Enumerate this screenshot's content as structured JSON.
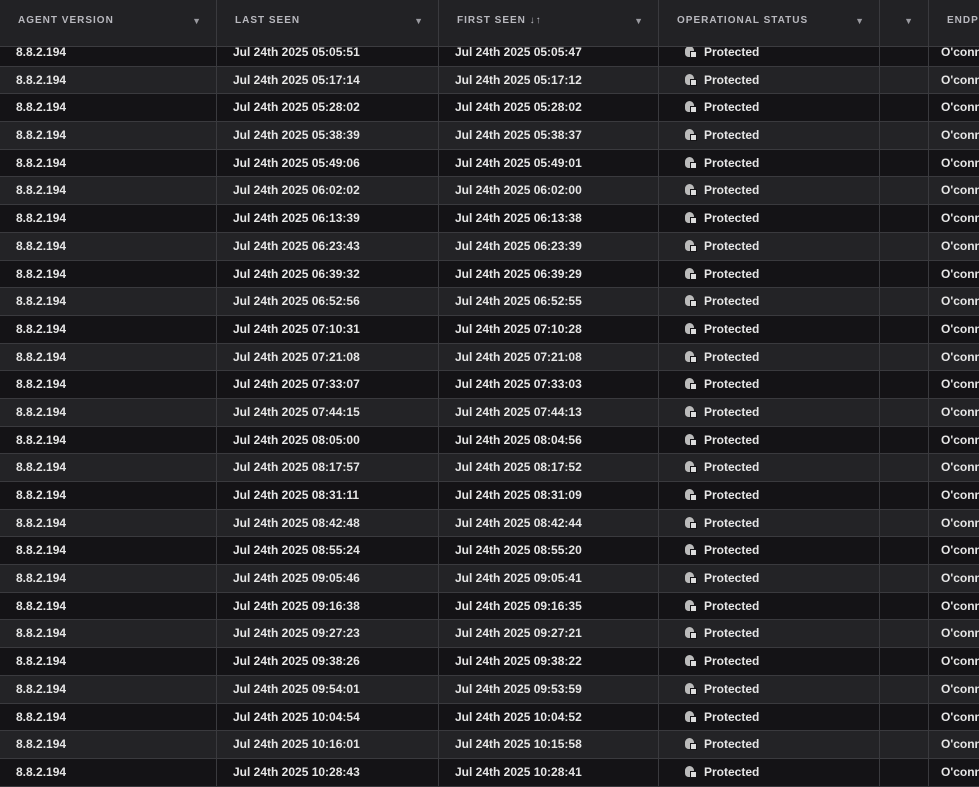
{
  "columns": [
    {
      "label": "AGENT VERSION",
      "filter": true
    },
    {
      "label": "LAST SEEN",
      "filter": true
    },
    {
      "label": "FIRST SEEN ↓↑",
      "filter": true
    },
    {
      "label": "OPERATIONAL STATUS",
      "filter": true
    },
    {
      "label": "",
      "filter": true
    },
    {
      "label": "ENDP",
      "filter": false
    }
  ],
  "filter_icon": "▼",
  "rows": [
    [
      "8.8.2.194",
      "Jul 24th 2025 05:05:51",
      "Jul 24th 2025 05:05:47",
      "Protected",
      "",
      "O'conn"
    ],
    [
      "8.8.2.194",
      "Jul 24th 2025 05:17:14",
      "Jul 24th 2025 05:17:12",
      "Protected",
      "",
      "O'conn"
    ],
    [
      "8.8.2.194",
      "Jul 24th 2025 05:28:02",
      "Jul 24th 2025 05:28:02",
      "Protected",
      "",
      "O'conn"
    ],
    [
      "8.8.2.194",
      "Jul 24th 2025 05:38:39",
      "Jul 24th 2025 05:38:37",
      "Protected",
      "",
      "O'conn"
    ],
    [
      "8.8.2.194",
      "Jul 24th 2025 05:49:06",
      "Jul 24th 2025 05:49:01",
      "Protected",
      "",
      "O'conn"
    ],
    [
      "8.8.2.194",
      "Jul 24th 2025 06:02:02",
      "Jul 24th 2025 06:02:00",
      "Protected",
      "",
      "O'conn"
    ],
    [
      "8.8.2.194",
      "Jul 24th 2025 06:13:39",
      "Jul 24th 2025 06:13:38",
      "Protected",
      "",
      "O'conn"
    ],
    [
      "8.8.2.194",
      "Jul 24th 2025 06:23:43",
      "Jul 24th 2025 06:23:39",
      "Protected",
      "",
      "O'conn"
    ],
    [
      "8.8.2.194",
      "Jul 24th 2025 06:39:32",
      "Jul 24th 2025 06:39:29",
      "Protected",
      "",
      "O'conn"
    ],
    [
      "8.8.2.194",
      "Jul 24th 2025 06:52:56",
      "Jul 24th 2025 06:52:55",
      "Protected",
      "",
      "O'conn"
    ],
    [
      "8.8.2.194",
      "Jul 24th 2025 07:10:31",
      "Jul 24th 2025 07:10:28",
      "Protected",
      "",
      "O'conn"
    ],
    [
      "8.8.2.194",
      "Jul 24th 2025 07:21:08",
      "Jul 24th 2025 07:21:08",
      "Protected",
      "",
      "O'conn"
    ],
    [
      "8.8.2.194",
      "Jul 24th 2025 07:33:07",
      "Jul 24th 2025 07:33:03",
      "Protected",
      "",
      "O'conn"
    ],
    [
      "8.8.2.194",
      "Jul 24th 2025 07:44:15",
      "Jul 24th 2025 07:44:13",
      "Protected",
      "",
      "O'conn"
    ],
    [
      "8.8.2.194",
      "Jul 24th 2025 08:05:00",
      "Jul 24th 2025 08:04:56",
      "Protected",
      "",
      "O'conn"
    ],
    [
      "8.8.2.194",
      "Jul 24th 2025 08:17:57",
      "Jul 24th 2025 08:17:52",
      "Protected",
      "",
      "O'conn"
    ],
    [
      "8.8.2.194",
      "Jul 24th 2025 08:31:11",
      "Jul 24th 2025 08:31:09",
      "Protected",
      "",
      "O'conn"
    ],
    [
      "8.8.2.194",
      "Jul 24th 2025 08:42:48",
      "Jul 24th 2025 08:42:44",
      "Protected",
      "",
      "O'conn"
    ],
    [
      "8.8.2.194",
      "Jul 24th 2025 08:55:24",
      "Jul 24th 2025 08:55:20",
      "Protected",
      "",
      "O'conn"
    ],
    [
      "8.8.2.194",
      "Jul 24th 2025 09:05:46",
      "Jul 24th 2025 09:05:41",
      "Protected",
      "",
      "O'conn"
    ],
    [
      "8.8.2.194",
      "Jul 24th 2025 09:16:38",
      "Jul 24th 2025 09:16:35",
      "Protected",
      "",
      "O'conn"
    ],
    [
      "8.8.2.194",
      "Jul 24th 2025 09:27:23",
      "Jul 24th 2025 09:27:21",
      "Protected",
      "",
      "O'conn"
    ],
    [
      "8.8.2.194",
      "Jul 24th 2025 09:38:26",
      "Jul 24th 2025 09:38:22",
      "Protected",
      "",
      "O'conn"
    ],
    [
      "8.8.2.194",
      "Jul 24th 2025 09:54:01",
      "Jul 24th 2025 09:53:59",
      "Protected",
      "",
      "O'conn"
    ],
    [
      "8.8.2.194",
      "Jul 24th 2025 10:04:54",
      "Jul 24th 2025 10:04:52",
      "Protected",
      "",
      "O'conn"
    ],
    [
      "8.8.2.194",
      "Jul 24th 2025 10:16:01",
      "Jul 24th 2025 10:15:58",
      "Protected",
      "",
      "O'conn"
    ],
    [
      "8.8.2.194",
      "Jul 24th 2025 10:28:43",
      "Jul 24th 2025 10:28:41",
      "Protected",
      "",
      "O'conn"
    ]
  ]
}
